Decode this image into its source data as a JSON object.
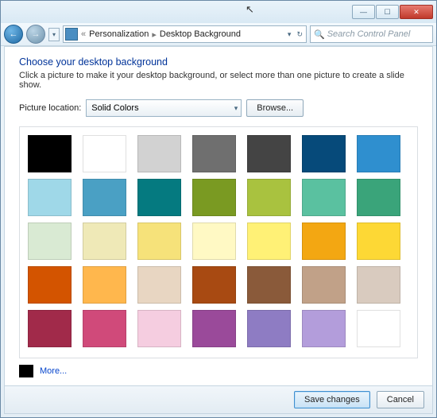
{
  "breadcrumb": {
    "parent": "Personalization",
    "current": "Desktop Background"
  },
  "search": {
    "placeholder": "Search Control Panel"
  },
  "page": {
    "title": "Choose your desktop background",
    "subtitle": "Click a picture to make it your desktop background, or select more than one picture to create a slide show."
  },
  "location": {
    "label": "Picture location:",
    "selected": "Solid Colors",
    "browse_label": "Browse..."
  },
  "swatches": [
    "#000000",
    "#ffffff",
    "#d2d2d2",
    "#6f6f6f",
    "#444444",
    "#064a7a",
    "#2f8fcf",
    "#9fd8e8",
    "#4aa0c4",
    "#057a80",
    "#7a9a22",
    "#a9c23f",
    "#5ac1a0",
    "#3aa47a",
    "#d9ead3",
    "#efe9b7",
    "#f6e27a",
    "#fff9c4",
    "#fff176",
    "#f3a712",
    "#fdd835",
    "#d35400",
    "#ffb74d",
    "#e8d6c2",
    "#a84a12",
    "#8a5a3a",
    "#c1a188",
    "#d9cbbf",
    "#a12a4a",
    "#d04a7a",
    "#f5cde0",
    "#9a4a9a",
    "#8e7cc3",
    "#b39ddb",
    "#ffffff"
  ],
  "more": {
    "label": "More..."
  },
  "footer": {
    "save": "Save changes",
    "cancel": "Cancel"
  }
}
